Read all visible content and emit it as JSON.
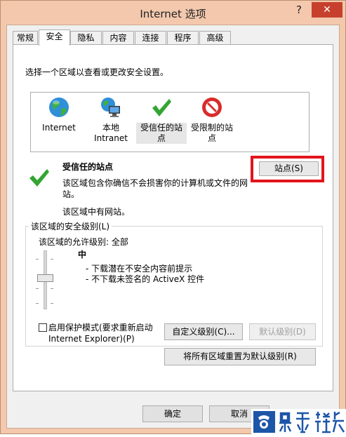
{
  "window": {
    "title": "Internet 选项",
    "help_glyph": "?",
    "close_glyph": "✕"
  },
  "tabs": [
    {
      "label": "常规"
    },
    {
      "label": "安全"
    },
    {
      "label": "隐私"
    },
    {
      "label": "内容"
    },
    {
      "label": "连接"
    },
    {
      "label": "程序"
    },
    {
      "label": "高级"
    }
  ],
  "active_tab": "安全",
  "security": {
    "instruction": "选择一个区域以查看或更改安全设置。",
    "zones": [
      {
        "label": "Internet",
        "icon": "globe-icon"
      },
      {
        "label": "本地\nIntranet",
        "icon": "intranet-icon"
      },
      {
        "label": "受信任的站\n点",
        "icon": "checkmark-icon",
        "selected": true
      },
      {
        "label": "受限制的站\n点",
        "icon": "no-entry-icon"
      }
    ],
    "zone_title": "受信任的站点",
    "zone_description": "该区域包含你确信不会损害你的计算机或文件的网站。",
    "zone_has_sites": "该区域中有网站。",
    "sites_button": "站点(S)",
    "level_group_title": "该区域的安全级别(L)",
    "allowed_levels": "该区域的允许级别: 全部",
    "level_name": "中",
    "level_bullets": [
      "- 下载潜在不安全内容前提示",
      "- 不下载未签名的 ActiveX 控件"
    ],
    "protected_mode_label": "启用保护模式(要求重新启动 Internet Explorer)(P)",
    "protected_mode_checked": false,
    "custom_level_button": "自定义级别(C)...",
    "default_level_button": "默认级别(D)",
    "reset_all_button": "将所有区域重置为默认级别(R)"
  },
  "footer": {
    "ok": "确定",
    "cancel": "取消"
  },
  "colors": {
    "title_bar": "#f3c8ad",
    "close_button": "#c7402e",
    "highlight_box": "#e2141c",
    "check_green": "#33a532"
  }
}
